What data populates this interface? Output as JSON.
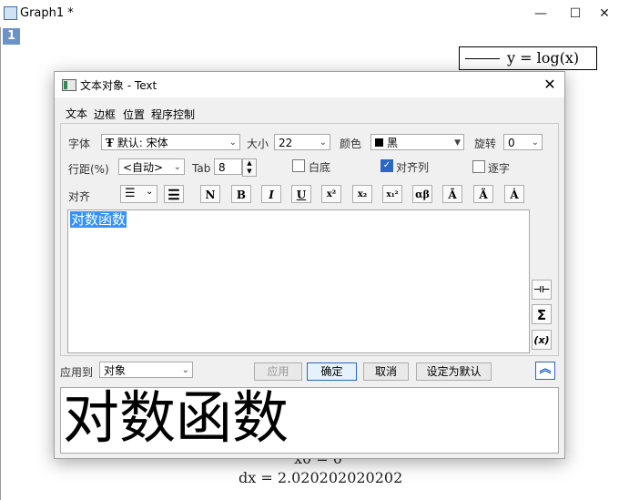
{
  "window": {
    "title": "Graph1 *",
    "minimize_glyph": "—",
    "maximize_glyph": "☐",
    "close_glyph": "✕"
  },
  "graph": {
    "layer_number": "1",
    "legend_text": "y = log(x)",
    "text_x0": "x0 = 0",
    "text_dx": "dx = 2.020202020202"
  },
  "dialog": {
    "title": "文本对象 - Text",
    "tabs": [
      "文本",
      "边框",
      "位置",
      "程序控制"
    ],
    "active_tab": "文本",
    "font_label": "字体",
    "font_value": "默认: 宋体",
    "size_label": "大小",
    "size_value": "22",
    "color_label": "颜色",
    "color_value": "黑",
    "rotate_label": "旋转",
    "rotate_value": "0",
    "spacing_label": "行距(%)",
    "spacing_value": "<自动>",
    "tab_label": "Tab",
    "tab_value": "8",
    "white_bg_label": "白底",
    "white_bg_checked": false,
    "align_column_label": "对齐列",
    "align_column_checked": true,
    "per_char_label": "逐字",
    "per_char_checked": false,
    "align_label": "对齐",
    "format_buttons": [
      "N",
      "B",
      "I",
      "U",
      "x²",
      "x₂",
      "x₁²",
      "αβ",
      "Ā",
      "Ã",
      "Ȧ"
    ],
    "editor_text": "对数函数",
    "side_buttons": [
      "⊣⊢",
      "Σ",
      "(x)"
    ],
    "apply_to_label": "应用到",
    "apply_to_value": "对象",
    "btn_apply": "应用",
    "btn_ok": "确定",
    "btn_cancel": "取消",
    "btn_set_default": "设定为默认",
    "preview_text": "对数函数"
  },
  "colors": {
    "accent": "#2a67c5",
    "selection": "#3392ff",
    "layer_tab": "#6b93c7"
  }
}
